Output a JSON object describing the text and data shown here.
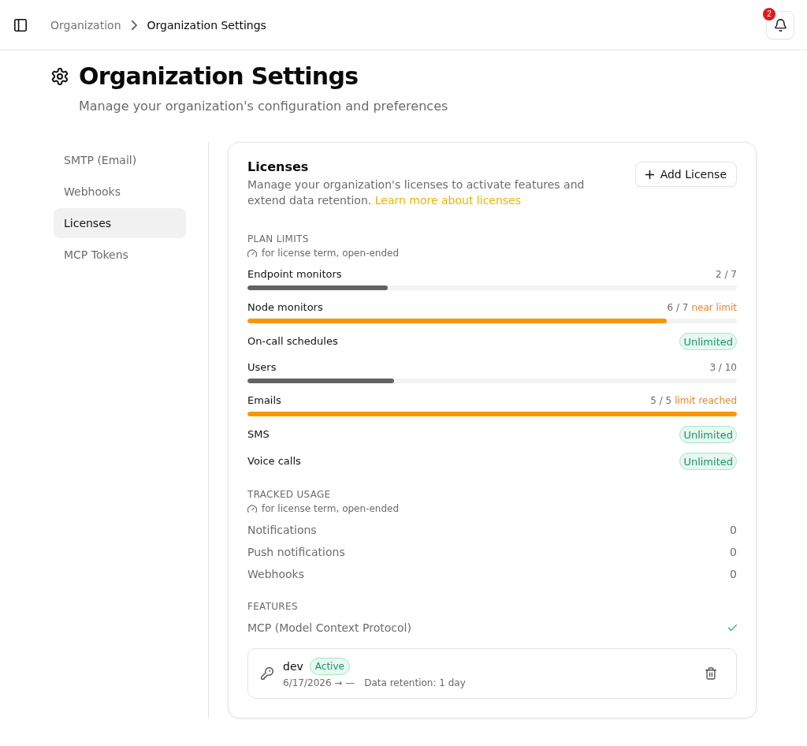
{
  "header": {
    "breadcrumbs": [
      {
        "label": "Organization",
        "current": false
      },
      {
        "label": "Organization Settings",
        "current": true
      }
    ],
    "notifications": {
      "count": "2"
    }
  },
  "page": {
    "title": "Organization Settings",
    "subtitle": "Manage your organization's configuration and preferences"
  },
  "sidebar": {
    "items": [
      {
        "label": "SMTP (Email)",
        "selected": false
      },
      {
        "label": "Webhooks",
        "selected": false
      },
      {
        "label": "Licenses",
        "selected": true
      },
      {
        "label": "MCP Tokens",
        "selected": false
      }
    ]
  },
  "licenses": {
    "title": "Licenses",
    "description": "Manage your organization's licenses to activate features and extend data retention.",
    "link": "Learn more about licenses",
    "add_button": "Add License",
    "plan_limits": {
      "heading": "PLAN LIMITS",
      "note": "for license term, open-ended",
      "items": [
        {
          "kind": "meter",
          "label": "Endpoint monitors",
          "reading": "2 / 7",
          "level": 0.286,
          "color": "#636363"
        },
        {
          "kind": "meter",
          "label": "Node monitors",
          "reading": "6 / 7",
          "warning": "near limit",
          "level": 0.857,
          "color": "#f79800"
        },
        {
          "kind": "unlimited",
          "label": "On-call schedules",
          "badge": "Unlimited"
        },
        {
          "kind": "meter",
          "label": "Users",
          "reading": "3 / 10",
          "level": 0.3,
          "color": "#636363"
        },
        {
          "kind": "meter",
          "label": "Emails",
          "reading": "5 / 5",
          "warning": "limit reached",
          "level": 1,
          "color": "#f79800"
        },
        {
          "kind": "unlimited",
          "label": "SMS",
          "badge": "Unlimited"
        },
        {
          "kind": "unlimited",
          "label": "Voice calls",
          "badge": "Unlimited"
        }
      ]
    },
    "tracked_usage": {
      "heading": "TRACKED USAGE",
      "note": "for license term, open-ended",
      "items": [
        {
          "label": "Notifications",
          "value": "0"
        },
        {
          "label": "Push notifications",
          "value": "0"
        },
        {
          "label": "Webhooks",
          "value": "0"
        }
      ]
    },
    "features": {
      "heading": "FEATURES",
      "items": [
        {
          "label": "MCP (Model Context Protocol)",
          "enabled": true
        }
      ]
    },
    "entries": [
      {
        "name": "dev",
        "status": "Active",
        "dates": "6/17/2026 → —",
        "retention": "Data retention: 1 day"
      }
    ]
  }
}
